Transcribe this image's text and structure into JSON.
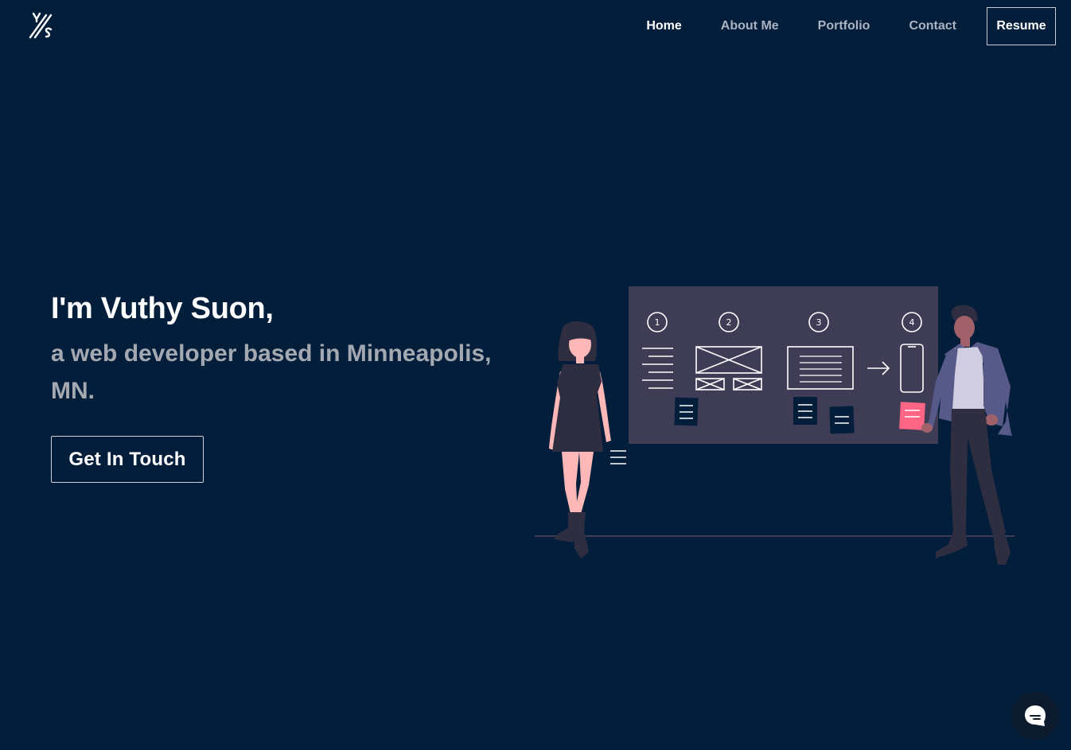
{
  "brand": {
    "logo_icon": "vs-monogram-logo"
  },
  "nav": {
    "items": [
      {
        "label": "Home",
        "active": true
      },
      {
        "label": "About Me",
        "active": false
      },
      {
        "label": "Portfolio",
        "active": false
      },
      {
        "label": "Contact",
        "active": false
      }
    ],
    "resume_label": "Resume"
  },
  "hero": {
    "title": "I'm Vuthy Suon,",
    "subtitle": "a web developer based in Minneapolis, MN.",
    "cta_label": "Get In Touch"
  },
  "illustration": {
    "steps": [
      "1",
      "2",
      "3",
      "4"
    ],
    "board_color": "#3f3d56",
    "accent_color": "#ff6584"
  },
  "chat": {
    "icon": "chat-bubble-icon"
  },
  "colors": {
    "background": "#021e3b",
    "text_primary": "#ffffff",
    "text_secondary": "#a4a9b1"
  }
}
